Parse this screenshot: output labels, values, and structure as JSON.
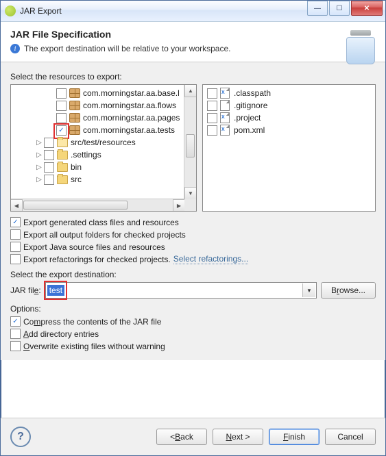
{
  "window": {
    "title": "JAR Export"
  },
  "header": {
    "title": "JAR File Specification",
    "subtitle": "The export destination will be relative to your workspace."
  },
  "resources_label": "Select the resources to export:",
  "tree": {
    "items": [
      {
        "label": "com.morningstar.aa.base.l",
        "icon": "package",
        "depth": 2,
        "checked": false,
        "expandable": false
      },
      {
        "label": "com.morningstar.aa.flows",
        "icon": "package",
        "depth": 2,
        "checked": false,
        "expandable": false
      },
      {
        "label": "com.morningstar.aa.pages",
        "icon": "package",
        "depth": 2,
        "checked": false,
        "expandable": false
      },
      {
        "label": "com.morningstar.aa.tests",
        "icon": "package",
        "depth": 2,
        "checked": true,
        "expandable": false,
        "highlighted": true
      },
      {
        "label": "src/test/resources",
        "icon": "folder-open",
        "depth": 1,
        "checked": false,
        "expandable": true
      },
      {
        "label": ".settings",
        "icon": "folder",
        "depth": 1,
        "checked": false,
        "expandable": true
      },
      {
        "label": "bin",
        "icon": "folder",
        "depth": 1,
        "checked": false,
        "expandable": true
      },
      {
        "label": "src",
        "icon": "folder",
        "depth": 1,
        "checked": false,
        "expandable": true
      }
    ]
  },
  "files": {
    "items": [
      {
        "label": ".classpath",
        "tag": "X",
        "checked": false
      },
      {
        "label": ".gitignore",
        "tag": "",
        "checked": false
      },
      {
        "label": ".project",
        "tag": "X",
        "checked": false
      },
      {
        "label": "pom.xml",
        "tag": "X",
        "checked": false
      }
    ]
  },
  "options1": {
    "export_class": {
      "label": "Export generated class files and resources",
      "checked": true
    },
    "export_output": {
      "label": "Export all output folders for checked projects",
      "checked": false
    },
    "export_source": {
      "label": "Export Java source files and resources",
      "checked": false
    },
    "export_refactor": {
      "label": "Export refactorings for checked projects.",
      "checked": false
    },
    "refactor_link": "Select refactorings..."
  },
  "destination": {
    "label": "Select the export destination:",
    "field_label": "JAR file:",
    "value": "test",
    "browse": "Browse..."
  },
  "options2": {
    "heading": "Options:",
    "compress": {
      "label": "Compress the contents of the JAR file",
      "checked": true
    },
    "adddir": {
      "label": "Add directory entries",
      "checked": false
    },
    "overwrite": {
      "label": "Overwrite existing files without warning",
      "checked": false
    }
  },
  "buttons": {
    "back": "< Back",
    "next": "Next >",
    "finish": "Finish",
    "cancel": "Cancel"
  }
}
